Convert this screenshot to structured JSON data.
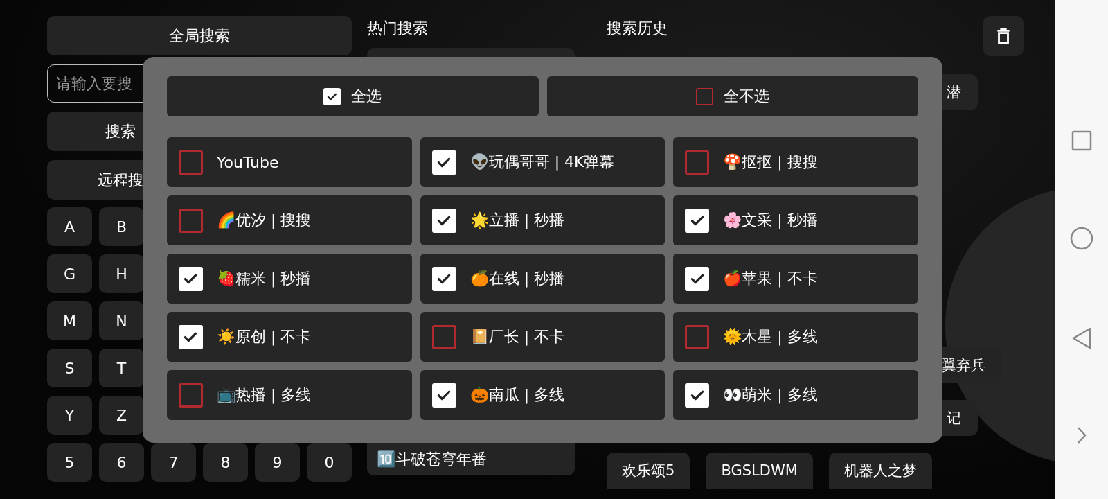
{
  "left_panel": {
    "global_search_button": "全局搜索",
    "search_input": {
      "placeholder": "请输入要搜"
    },
    "search_button": "搜索",
    "remote_search_button": "远程搜",
    "keyboard": [
      [
        "A",
        "B"
      ],
      [
        "G",
        "H"
      ],
      [
        "M",
        "N"
      ],
      [
        "S",
        "T"
      ],
      [
        "Y",
        "Z"
      ],
      [
        "5",
        "6",
        "7",
        "8",
        "9",
        "0"
      ]
    ]
  },
  "hot_search": {
    "title": "热门搜索",
    "items": [
      "🔟斗破苍穹年番"
    ]
  },
  "search_history": {
    "title": "搜索历史",
    "tag_rows": [
      [
        "潜"
      ],
      [
        "翼弃兵"
      ],
      [
        "记"
      ],
      [
        "欢乐颂5",
        "BGSLDWM",
        "机器人之梦"
      ]
    ]
  },
  "dialog": {
    "select_all": {
      "label": "全选",
      "checked": true
    },
    "select_none": {
      "label": "全不选",
      "checked": false
    },
    "sources": [
      {
        "label": "YouTube",
        "checked": false
      },
      {
        "label": "👽玩偶哥哥 | 4K弹幕",
        "checked": true
      },
      {
        "label": "🍄抠抠 | 搜搜",
        "checked": false
      },
      {
        "label": "🌈优汐 | 搜搜",
        "checked": false
      },
      {
        "label": "🌟立播 | 秒播",
        "checked": true
      },
      {
        "label": "🌸文采 | 秒播",
        "checked": true
      },
      {
        "label": "🍓糯米 | 秒播",
        "checked": true
      },
      {
        "label": "🍊在线 | 秒播",
        "checked": true
      },
      {
        "label": "🍎苹果 | 不卡",
        "checked": true
      },
      {
        "label": "☀️原创 | 不卡",
        "checked": true
      },
      {
        "label": "📔厂长 | 不卡",
        "checked": false
      },
      {
        "label": "🌞木星 | 多线",
        "checked": false
      },
      {
        "label": "📺热播 | 多线",
        "checked": false
      },
      {
        "label": "🎃南瓜 | 多线",
        "checked": true
      },
      {
        "label": "👀萌米 | 多线",
        "checked": true
      }
    ]
  }
}
